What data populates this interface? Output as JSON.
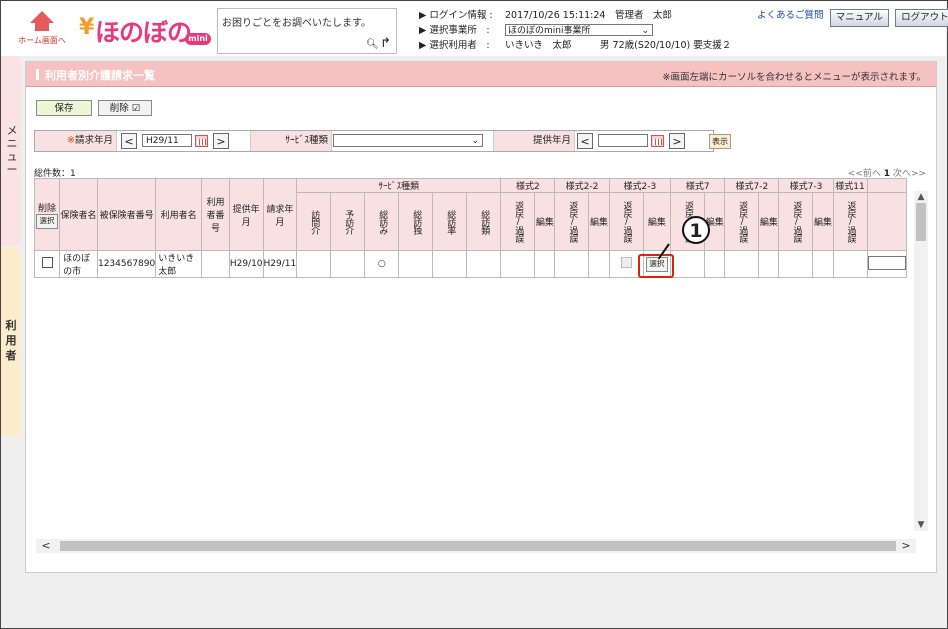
{
  "header": {
    "home_label": "ホーム画面へ",
    "logo_text": "ほのぼの",
    "logo_mini": "mini",
    "search_placeholder": "お困りごとをお調べいたします。",
    "login_label": "▶ ログイン情報 :",
    "login_value": "2017/10/26 15:11:24　管理者　太郎",
    "office_label": "▶ 選択事業所　:",
    "office_value": "ほのぼのmini事業所",
    "user_label": "▶ 選択利用者　:",
    "user_value": "いきいき　太郎　　　男 72歳(S20/10/10) 要支援２",
    "faq_link": "よくあるご質問",
    "manual_button": "マニュアル",
    "logout_button": "ログアウト"
  },
  "sidebar": {
    "menu_label": "メニュー",
    "user_label": "利用者"
  },
  "page": {
    "title": "利用者別介護請求一覧",
    "note": "※画面左端にカーソルを合わせるとメニューが表示されます。",
    "save_button": "保存",
    "delete_button": "削除 ☑"
  },
  "conditions": {
    "claim_month_mark": "※",
    "claim_month_label": "請求年月",
    "claim_month_value": "H29/11",
    "service_type_label": "ｻｰﾋﾞｽ種類",
    "service_type_value": "",
    "provide_month_label": "提供年月",
    "provide_month_value": "",
    "display_button": "表示"
  },
  "list": {
    "total_label": "総件数：1",
    "pager_prev": "<<前へ",
    "pager_current": "1",
    "pager_next": "次へ>>",
    "headers": {
      "delete": "削除",
      "select_btn": "選択",
      "insurer": "保険者名",
      "insured_no": "被保険者番号",
      "user_name": "利用者名",
      "user_no": "利用者番号",
      "provide_month": "提供年月",
      "claim_month": "請求年月",
      "service_kind": "ｻｰﾋﾞｽ種類",
      "kind_cols": [
        "訪問介",
        "予訪介",
        "総訪み",
        "総訪独",
        "総訪率",
        "総訪類"
      ],
      "form_groups": [
        "様式2",
        "様式2-2",
        "様式2-3",
        "様式7",
        "様式7-2",
        "様式7-3",
        "様式11"
      ],
      "return_label": "返戻/過誤",
      "edit_label": "編集"
    },
    "rows": [
      {
        "insurer": "ほのぼの市",
        "insured_no": "1234567890",
        "user_name": "いきいき　太郎",
        "user_no": "",
        "provide_month": "H29/10",
        "claim_month": "H29/11",
        "kind_mark": "○",
        "select_button": "選択"
      }
    ]
  },
  "callout": {
    "number": "1"
  }
}
